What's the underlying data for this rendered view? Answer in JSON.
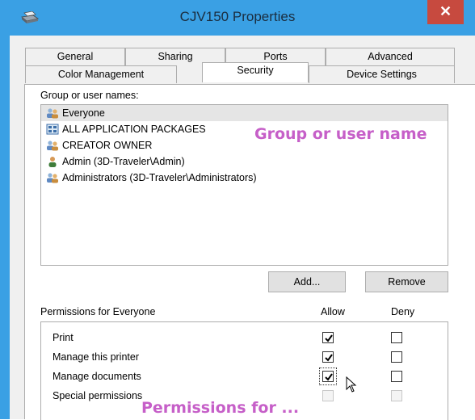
{
  "window": {
    "title": "CJV150 Properties",
    "close_label": "✕"
  },
  "tabs": {
    "row1": [
      "General",
      "Sharing",
      "Ports",
      "Advanced"
    ],
    "row2": [
      "Color Management",
      "Security",
      "Device Settings"
    ],
    "active": "Security"
  },
  "users": {
    "label": "Group or user names:",
    "items": [
      {
        "name": "Everyone",
        "icon": "group-users-icon",
        "selected": true
      },
      {
        "name": "ALL APPLICATION PACKAGES",
        "icon": "app-packages-icon",
        "selected": false
      },
      {
        "name": "CREATOR OWNER",
        "icon": "group-users-icon",
        "selected": false
      },
      {
        "name": "Admin (3D-Traveler\\Admin)",
        "icon": "user-icon",
        "selected": false
      },
      {
        "name": "Administrators (3D-Traveler\\Administrators)",
        "icon": "group-users-icon",
        "selected": false
      }
    ],
    "annotation": "Group or user name"
  },
  "buttons": {
    "add": "Add...",
    "remove": "Remove"
  },
  "permissions": {
    "label": "Permissions for Everyone",
    "allow_header": "Allow",
    "deny_header": "Deny",
    "rows": [
      {
        "name": "Print",
        "allow": true,
        "deny": false,
        "disabled": false
      },
      {
        "name": "Manage this printer",
        "allow": true,
        "deny": false,
        "disabled": false
      },
      {
        "name": "Manage documents",
        "allow": true,
        "deny": false,
        "disabled": false
      },
      {
        "name": "Special permissions",
        "allow": false,
        "deny": false,
        "disabled": true
      }
    ],
    "annotation": "Permissions for ..."
  },
  "colors": {
    "titlebar": "#3aa0e4",
    "close": "#c74a3f",
    "annotation": "#c65fc8"
  }
}
